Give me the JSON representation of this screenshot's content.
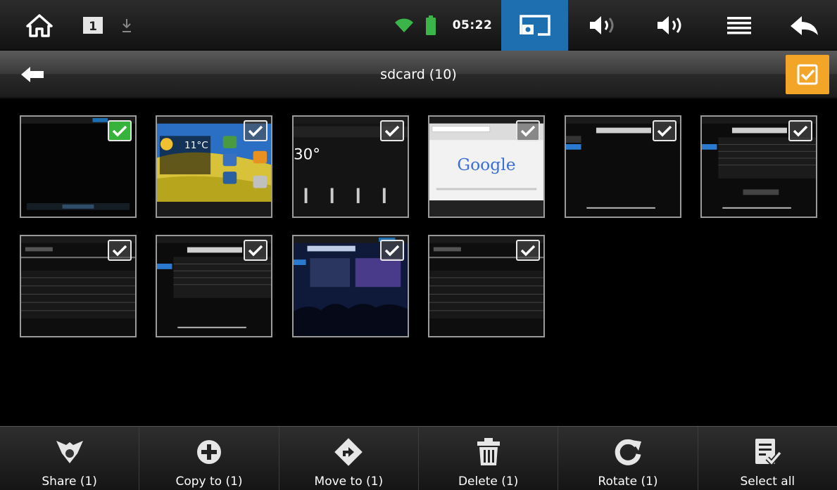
{
  "status_bar": {
    "sd_indicator": "1",
    "time": "05:22",
    "icons": [
      "home-icon",
      "sim-card-icon",
      "download-icon",
      "wifi-icon",
      "battery-icon",
      "screenshot-icon",
      "volume-down-icon",
      "volume-up-icon",
      "menu-icon",
      "back-icon"
    ],
    "colors": {
      "wifi": "#3bb54a",
      "battery": "#3bb54a",
      "active_tab": "#1d6fb0"
    }
  },
  "title_bar": {
    "title": "sdcard (10)",
    "back_icon": "arrow-left-icon",
    "select_toggle_icon": "checkbox-checked-icon",
    "accent": "#f2a526"
  },
  "grid": {
    "count": 10,
    "items": [
      {
        "name": "thumbnail-1",
        "selected": true
      },
      {
        "name": "thumbnail-2",
        "selected": false
      },
      {
        "name": "thumbnail-3",
        "selected": false
      },
      {
        "name": "thumbnail-4",
        "selected": false
      },
      {
        "name": "thumbnail-5",
        "selected": false
      },
      {
        "name": "thumbnail-6",
        "selected": false
      },
      {
        "name": "thumbnail-7",
        "selected": false
      },
      {
        "name": "thumbnail-8",
        "selected": false
      },
      {
        "name": "thumbnail-9",
        "selected": false
      },
      {
        "name": "thumbnail-10",
        "selected": false
      }
    ],
    "thumb_texts": {
      "weather_temp": "30°",
      "search_logo": "Google",
      "home_temp": "11°C"
    }
  },
  "action_bar": {
    "share": "Share (1)",
    "copy": "Copy to (1)",
    "move": "Move to (1)",
    "delete": "Delete (1)",
    "rotate": "Rotate (1)",
    "select_all": "Select all"
  }
}
